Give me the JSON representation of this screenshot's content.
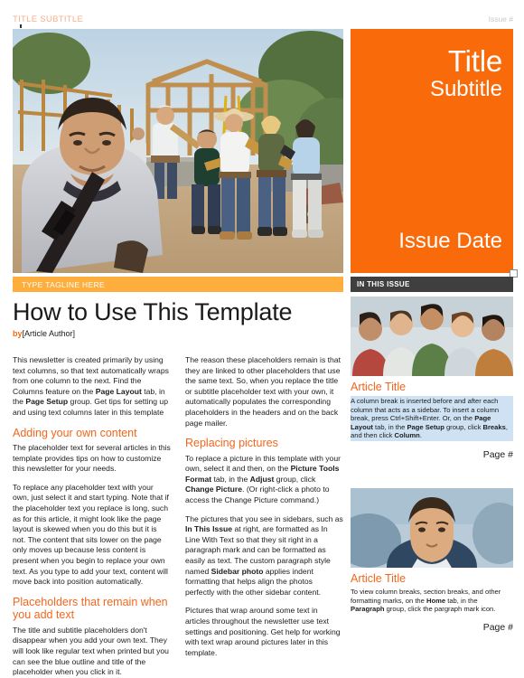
{
  "running_header": {
    "title": "TITLE SUBTITLE",
    "issue": "Issue #"
  },
  "hero": {
    "title": "Title",
    "subtitle": "Subtitle",
    "issue_date": "Issue Date",
    "photo_alt": "construction-volunteers-photo"
  },
  "bars": {
    "tagline": "TYPE TAGLINE HERE",
    "in_this_issue": "IN THIS ISSUE"
  },
  "article": {
    "headline": "How to Use This Template",
    "byline_prefix": "by",
    "byline_author": "[Article Author]",
    "column_left": {
      "p1": "This newsletter is created primarily by using text columns, so that text automatically wraps from one column to the next. Find the Columns feature on the ",
      "p1_b1": "Page Layout",
      "p1_mid": " tab, in the ",
      "p1_b2": "Page Setup",
      "p1_end": " group. Get tips for setting up and using text columns later in this template",
      "h1": "Adding your own content",
      "p2": "The placeholder text for several articles in this template provides tips on how to customize this newsletter for your needs.",
      "p3": "To replace any placeholder text with your own, just select it and start typing. Note that if the placeholder text you replace is long, such as for this article, it might look like the page layout is skewed when you do this but it is not. The content that sits lower on the page only moves up because less content is present when you begin to replace your own text. As you type to add your text, content will move back into position automatically.",
      "h2": "Placeholders that remain when you add text",
      "p4": "The title and subtitle placeholders don't disappear when you add your own text. They will look like regular text when printed but you can see the blue outline and title of the placeholder when you click in it."
    },
    "column_right": {
      "p1": "The reason these placeholders remain is that they are linked to other placeholders that use the same text. So, when you replace the title or subtitle placeholder text with your own, it automatically populates the corresponding placeholders in the headers and on the back page mailer.",
      "h1": "Replacing pictures",
      "p2_a": "To replace a picture in this template with your own, select it and then, on the ",
      "p2_b1": "Picture Tools Format",
      "p2_mid1": " tab, in the ",
      "p2_b2": "Adjust",
      "p2_mid2": " group, click ",
      "p2_b3": "Change Picture",
      "p2_end": ". (Or right-click a photo to access the Change Picture command.)",
      "p3_a": "The pictures that you see in sidebars, such as ",
      "p3_b1": "In This Issue",
      "p3_mid": " at right, are formatted as In Line With Text so that they sit right in a paragraph mark and can be formatted as easily as text. The custom paragraph style named ",
      "p3_b2": "Sidebar photo",
      "p3_end": " applies indent formatting that helps align the photos perfectly with the other sidebar content.",
      "p4": "Pictures that wrap around some text in articles throughout the newsletter use text settings and positioning. Get help for working with text wrap around pictures later in this template."
    }
  },
  "sidebar": {
    "articles": [
      {
        "photo_alt": "group-of-people-photo",
        "title": "Article Title",
        "body_a": "A column break is inserted before and after each column that acts as a sidebar. To insert a column break, press Ctrl+Shift+Enter. Or, on the ",
        "body_b1": "Page Layout",
        "body_mid1": " tab, in the ",
        "body_b2": "Page Setup",
        "body_mid2": " group, click ",
        "body_b3": "Breaks",
        "body_mid3": ", and then click ",
        "body_b4": "Column",
        "body_end": ".",
        "page": "Page #",
        "selected": true
      },
      {
        "photo_alt": "man-portrait-photo",
        "title": "Article Title",
        "body_a": "To view column breaks, section breaks, and other formatting marks, on the ",
        "body_b1": "Home",
        "body_mid1": " tab, in the ",
        "body_b2": "Paragraph",
        "body_mid2": " group, click the pargraph mark icon.",
        "body_b3": "",
        "body_mid3": "",
        "body_b4": "",
        "body_end": "",
        "page": "Page #",
        "selected": false
      }
    ]
  },
  "colors": {
    "accent_orange": "#f96a0b",
    "heading_orange": "#f4661c",
    "tagline_amber": "#fdae3c",
    "bar_dark": "#3f3f3f",
    "header_tint": "#f8b08a",
    "selection_blue": "#cfe2f3"
  }
}
